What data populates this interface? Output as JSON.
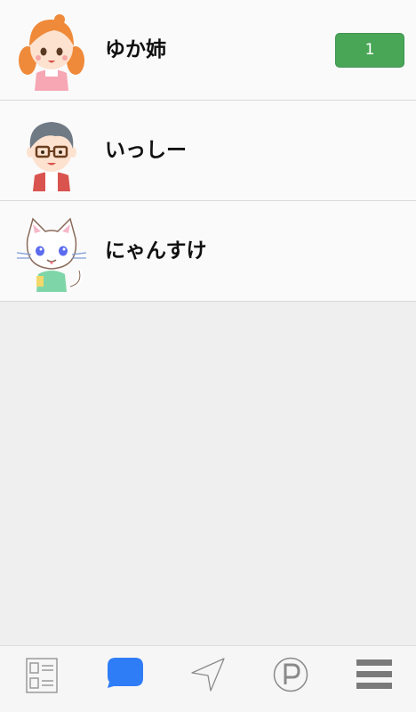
{
  "contacts": [
    {
      "name": "ゆか姉",
      "avatar_icon": "girl-avatar-icon",
      "badge": "1"
    },
    {
      "name": "いっしー",
      "avatar_icon": "glasses-boy-avatar-icon"
    },
    {
      "name": "にゃんすけ",
      "avatar_icon": "cat-avatar-icon"
    }
  ],
  "tabbar": {
    "tabs": [
      {
        "icon": "list-document-icon",
        "active": false
      },
      {
        "icon": "chat-bubble-icon",
        "active": true
      },
      {
        "icon": "send-arrow-icon",
        "active": false
      },
      {
        "icon": "parking-p-icon",
        "active": false
      },
      {
        "icon": "hamburger-menu-icon",
        "active": false
      }
    ]
  },
  "colors": {
    "badge": "#4aa657",
    "active_tab": "#2f7df6",
    "inactive_tab": "#8a8a8a",
    "background": "#efefef"
  }
}
